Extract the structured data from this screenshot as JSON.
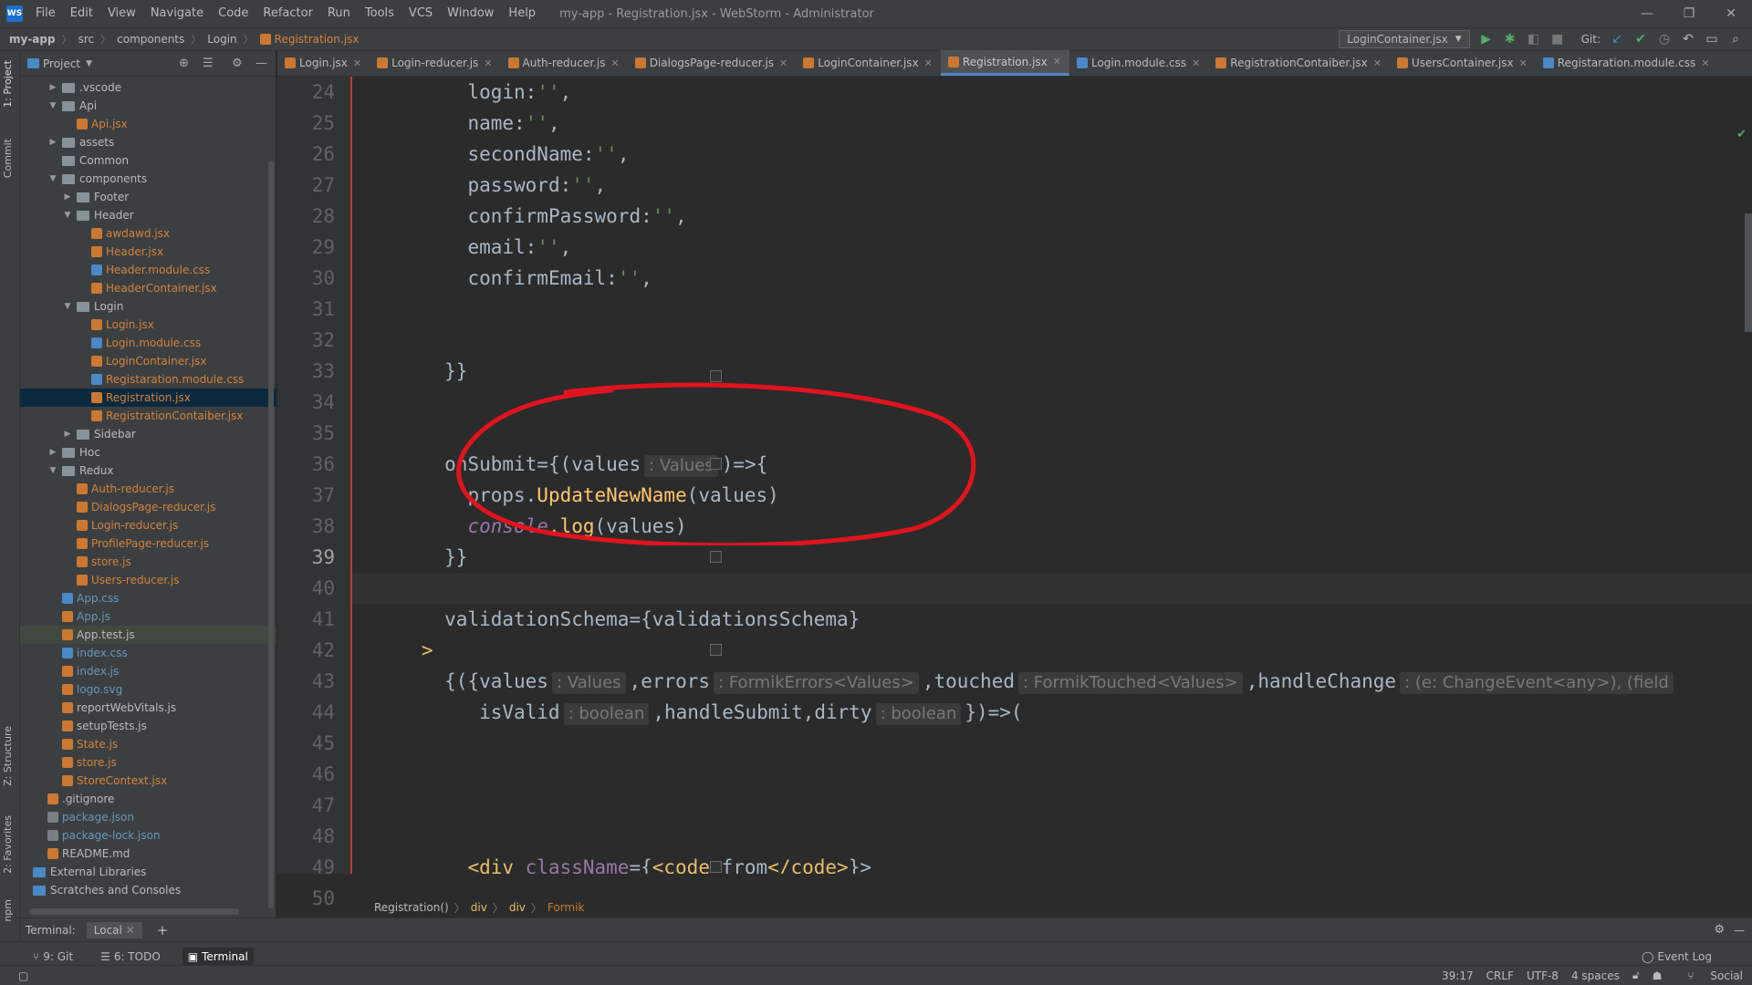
{
  "window": {
    "logo": "WS",
    "menu": [
      "File",
      "Edit",
      "View",
      "Navigate",
      "Code",
      "Refactor",
      "Run",
      "Tools",
      "VCS",
      "Window",
      "Help"
    ],
    "title": "my-app - Registration.jsx - WebStorm - Administrator",
    "controls": [
      "—",
      "❐",
      "✕"
    ]
  },
  "navbar": {
    "crumbs": [
      "my-app",
      "src",
      "components",
      "Login",
      "Registration.jsx"
    ],
    "run_config": "LoginContainer.jsx",
    "git_label": "Git:"
  },
  "sidebar_left": {
    "project_label": "1: Project",
    "commit_label": "Commit",
    "structure_label": "Z: Structure",
    "favorites_label": "2: Favorites",
    "npm_label": "npm"
  },
  "project": {
    "title": "Project",
    "tree": [
      {
        "name": ".vscode",
        "type": "folder",
        "level": 2,
        "arrow": "▶"
      },
      {
        "name": "Api",
        "type": "folder",
        "level": 2,
        "arrow": "▼"
      },
      {
        "name": "Api.jsx",
        "type": "file",
        "level": 3,
        "color": "orange"
      },
      {
        "name": "assets",
        "type": "folder",
        "level": 2,
        "arrow": "▶"
      },
      {
        "name": "Common",
        "type": "folder",
        "level": 2,
        "arrow": ""
      },
      {
        "name": "components",
        "type": "folder",
        "level": 2,
        "arrow": "▼"
      },
      {
        "name": "Footer",
        "type": "folder",
        "level": 3,
        "arrow": "▶"
      },
      {
        "name": "Header",
        "type": "folder",
        "level": 3,
        "arrow": "▼"
      },
      {
        "name": "awdawd.jsx",
        "type": "file",
        "level": 4,
        "color": "orange"
      },
      {
        "name": "Header.jsx",
        "type": "file",
        "level": 4,
        "color": "orange"
      },
      {
        "name": "Header.module.css",
        "type": "file",
        "level": 4,
        "color": "orange"
      },
      {
        "name": "HeaderContainer.jsx",
        "type": "file",
        "level": 4,
        "color": "orange"
      },
      {
        "name": "Login",
        "type": "folder",
        "level": 3,
        "arrow": "▼"
      },
      {
        "name": "Login.jsx",
        "type": "file",
        "level": 4,
        "color": "orange"
      },
      {
        "name": "Login.module.css",
        "type": "file",
        "level": 4,
        "color": "orange"
      },
      {
        "name": "LoginContainer.jsx",
        "type": "file",
        "level": 4,
        "color": "orange"
      },
      {
        "name": "Registaration.module.css",
        "type": "file",
        "level": 4,
        "color": "orange"
      },
      {
        "name": "Registration.jsx",
        "type": "file",
        "level": 4,
        "color": "orange",
        "selected": true
      },
      {
        "name": "RegistrationContaiber.jsx",
        "type": "file",
        "level": 4,
        "color": "orange"
      },
      {
        "name": "Sidebar",
        "type": "folder",
        "level": 3,
        "arrow": "▶"
      },
      {
        "name": "Hoc",
        "type": "folder",
        "level": 2,
        "arrow": "▶"
      },
      {
        "name": "Redux",
        "type": "folder",
        "level": 2,
        "arrow": "▼"
      },
      {
        "name": "Auth-reducer.js",
        "type": "file",
        "level": 3,
        "color": "orange"
      },
      {
        "name": "DialogsPage-reducer.js",
        "type": "file",
        "level": 3,
        "color": "orange"
      },
      {
        "name": "Login-reducer.js",
        "type": "file",
        "level": 3,
        "color": "orange"
      },
      {
        "name": "ProfilePage-reducer.js",
        "type": "file",
        "level": 3,
        "color": "orange"
      },
      {
        "name": "store.js",
        "type": "file",
        "level": 3,
        "color": "orange"
      },
      {
        "name": "Users-reducer.js",
        "type": "file",
        "level": 3,
        "color": "orange"
      },
      {
        "name": "App.css",
        "type": "file",
        "level": 2,
        "color": "blue"
      },
      {
        "name": "App.js",
        "type": "file",
        "level": 2,
        "color": "blue"
      },
      {
        "name": "App.test.js",
        "type": "file",
        "level": 2,
        "color": "plain",
        "highlight": true
      },
      {
        "name": "index.css",
        "type": "file",
        "level": 2,
        "color": "blue"
      },
      {
        "name": "index.js",
        "type": "file",
        "level": 2,
        "color": "blue"
      },
      {
        "name": "logo.svg",
        "type": "file",
        "level": 2,
        "color": "blue"
      },
      {
        "name": "reportWebVitals.js",
        "type": "file",
        "level": 2,
        "color": "plain"
      },
      {
        "name": "setupTests.js",
        "type": "file",
        "level": 2,
        "color": "plain"
      },
      {
        "name": "State.js",
        "type": "file",
        "level": 2,
        "color": "orange"
      },
      {
        "name": "store.js",
        "type": "file",
        "level": 2,
        "color": "orange"
      },
      {
        "name": "StoreContext.jsx",
        "type": "file",
        "level": 2,
        "color": "orange"
      },
      {
        "name": ".gitignore",
        "type": "file",
        "level": 1,
        "color": "plain"
      },
      {
        "name": "package.json",
        "type": "file",
        "level": 1,
        "color": "blue"
      },
      {
        "name": "package-lock.json",
        "type": "file",
        "level": 1,
        "color": "blue"
      },
      {
        "name": "README.md",
        "type": "file",
        "level": 1,
        "color": "plain"
      },
      {
        "name": "External Libraries",
        "type": "lib",
        "level": 0
      },
      {
        "name": "Scratches and Consoles",
        "type": "lib",
        "level": 0
      }
    ]
  },
  "tabs": [
    {
      "label": "Login.jsx"
    },
    {
      "label": "Login-reducer.js"
    },
    {
      "label": "Auth-reducer.js"
    },
    {
      "label": "DialogsPage-reducer.js"
    },
    {
      "label": "LoginContainer.jsx"
    },
    {
      "label": "Registration.jsx",
      "active": true
    },
    {
      "label": "Login.module.css"
    },
    {
      "label": "RegistrationContaiber.jsx"
    },
    {
      "label": "UsersContainer.jsx"
    },
    {
      "label": "Registaration.module.css"
    }
  ],
  "code": {
    "lines": [
      24,
      25,
      26,
      27,
      28,
      29,
      30,
      31,
      32,
      33,
      34,
      35,
      36,
      37,
      38,
      39,
      40,
      41,
      42,
      43,
      44,
      45,
      46,
      47,
      48,
      49,
      50
    ],
    "text": {
      "l24": "login",
      "l25": "name",
      "l26": "secondName",
      "l27": "password",
      "l28": "confirmPassword",
      "l29": "email",
      "l30": "confirmEmail",
      "empty_str": "''",
      "colon": ":",
      "comma": ",",
      "close_braces": "}}",
      "onsubmit": "onSubmit={(values",
      "values_hint": ": Values",
      "arrow_open": ")=>{",
      "props": "props.",
      "update_fn": "UpdateNewName",
      "args": "(values)",
      "console": "console",
      "dotlog": ".log",
      "validation": "validationSchema={validationsSchema}",
      "gt": ">",
      "open_obj": "{({values",
      "errors": ",errors",
      "errors_hint": ": FormikErrors<Values>",
      "touched": ",touched",
      "touched_hint": ": FormikTouched<Values>",
      "handlechange": ",handleChange",
      "handlechange_hint": ": (e: ChangeEvent<any>), (field",
      "isvalid": "isValid",
      "bool_hint": ": boolean",
      "handlesubmit": ",handleSubmit,dirty",
      "close_obj": "})=>(",
      "div_open": "<div",
      "classname": " className",
      "eq_brace": "={",
      "code_open": "<code>",
      "from": "from",
      "code_close": "</code>",
      "close_brace_gt": "}>"
    }
  },
  "breadcrumb": [
    "Registration()",
    "div",
    "div",
    "Formik"
  ],
  "terminal": {
    "label": "Terminal:",
    "tab": "Local",
    "add": "+"
  },
  "toolwindows": [
    {
      "label": "9: Git",
      "icon": "git-icon"
    },
    {
      "label": "6: TODO",
      "icon": "todo-icon"
    },
    {
      "label": "Terminal",
      "icon": "terminal-icon",
      "active": true
    }
  ],
  "event_log": "Event Log",
  "status": {
    "position": "39:17",
    "line_sep": "CRLF",
    "encoding": "UTF-8",
    "indent": "4 spaces",
    "social": "Social"
  },
  "colors": {
    "annotation": "#e0141e",
    "accent": "#4a88c7"
  }
}
